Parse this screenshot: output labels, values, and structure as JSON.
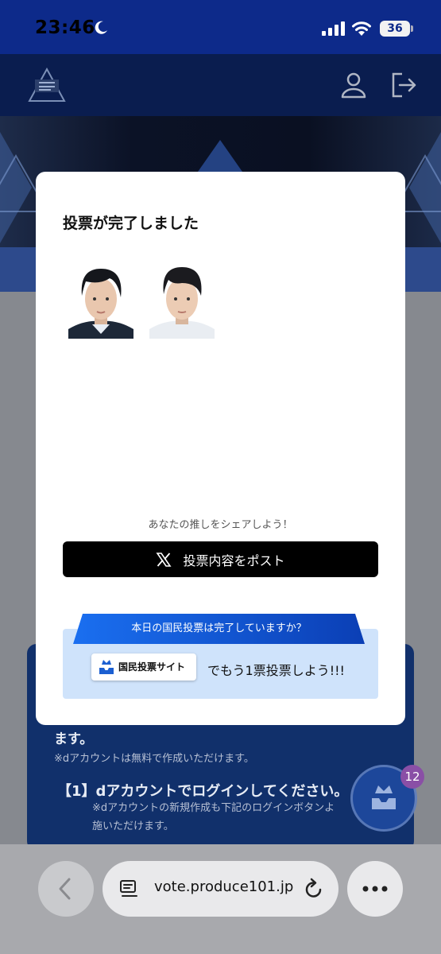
{
  "status_bar": {
    "time": "23:46",
    "battery": "36"
  },
  "background": {
    "body_line_1": "ます。",
    "body_line_2": "※dアカウントは無料で作成いただけます。",
    "step_1": "【1】dアカウントでログインしてください。",
    "step_1_note_a": "※dアカウントの新規作成も下記のログインボタンよ",
    "step_1_note_b": "施いただけます。",
    "notification_badge": "12"
  },
  "modal": {
    "title": "投票が完了しました",
    "share_prompt": "あなたの推しをシェアしよう！",
    "post_button_label": "投票内容をポスト",
    "vote_ribbon": "本日の国民投票は完了していますか？",
    "site_button_label": "国民投票サイト",
    "vote_cta": "でもう1票投票しよう!!!"
  },
  "browser": {
    "url": "vote.produce101.jp"
  },
  "colors": {
    "header_blue": "#0d2a8a",
    "post_button": "#000000",
    "ribbon_blue": "#0a59d8",
    "vote_box": "#cfe3fb"
  }
}
